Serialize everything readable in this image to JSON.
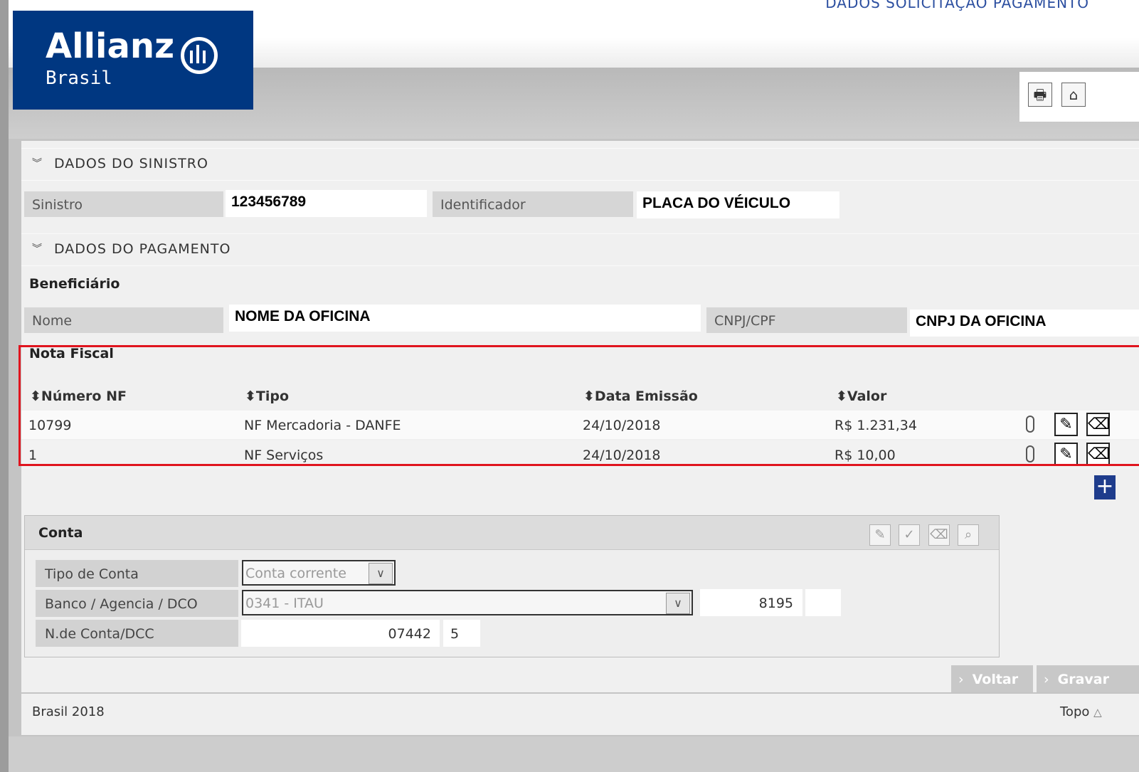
{
  "header": {
    "page_title": "DADOS SOLICITAÇÃO PAGAMENTO",
    "logo_brand": "Allianz",
    "logo_sub": "Brasil",
    "brand_color": "#003781",
    "tools": {
      "print_icon": "printer-icon",
      "home_icon": "home-icon"
    }
  },
  "sinistro_section": {
    "title": "DADOS DO SINISTRO",
    "sinistro_label": "Sinistro",
    "sinistro_value": "123456789",
    "identificador_label": "Identificador",
    "identificador_value": "PLACA DO VÉICULO"
  },
  "pagamento_section": {
    "title": "DADOS DO PAGAMENTO",
    "beneficiario_label": "Beneficiário",
    "nome_label": "Nome",
    "nome_value": "NOME DA OFICINA",
    "cnpj_label": "CNPJ/CPF",
    "cnpj_value": "CNPJ DA OFICINA"
  },
  "nota_fiscal": {
    "title": "Nota Fiscal",
    "highlight_color": "#e0141e",
    "columns": [
      "Número NF",
      "Tipo",
      "Data Emissão",
      "Valor"
    ],
    "rows": [
      {
        "numero": "10799",
        "tipo": "NF Mercadoria - DANFE",
        "data": "24/10/2018",
        "valor": "R$ 1.231,34"
      },
      {
        "numero": "1",
        "tipo": "NF Serviços",
        "data": "24/10/2018",
        "valor": "R$ 10,00"
      }
    ],
    "add_label": "+"
  },
  "conta": {
    "title": "Conta",
    "tipo_label": "Tipo de Conta",
    "tipo_value": "Conta corrente",
    "banco_label": "Banco / Agencia / DCO",
    "banco_value": "0341 - ITAU",
    "agencia_value": "8195",
    "dco_value": "",
    "numero_label": "N.de Conta/DCC",
    "conta_value": "07442",
    "dcc_value": "5"
  },
  "actions": {
    "voltar": "Voltar",
    "gravar": "Gravar"
  },
  "footer": {
    "copyright": "Brasil 2018",
    "top_link": "Topo"
  }
}
